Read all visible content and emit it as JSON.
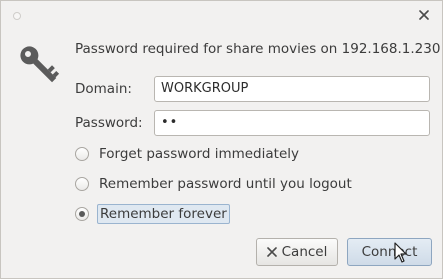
{
  "titlebar": {
    "close_icon": "close-icon",
    "window_icon": "window-dot-icon"
  },
  "dialog": {
    "icon": "key-icon",
    "message": "Password required for share movies on 192.168.1.230",
    "domain_label": "Domain:",
    "domain_value": "WORKGROUP",
    "password_label": "Password:",
    "password_value": "••",
    "options": [
      {
        "label": "Forget password immediately",
        "checked": false
      },
      {
        "label": "Remember password until you logout",
        "checked": false
      },
      {
        "label": "Remember forever",
        "checked": true
      }
    ],
    "cancel_label": "Cancel",
    "connect_label": "Connect"
  },
  "colors": {
    "background": "#f2f1f0",
    "text": "#3c3c3c",
    "focus_highlight": "#dfe8f1",
    "default_button": "#cfdbe8"
  }
}
